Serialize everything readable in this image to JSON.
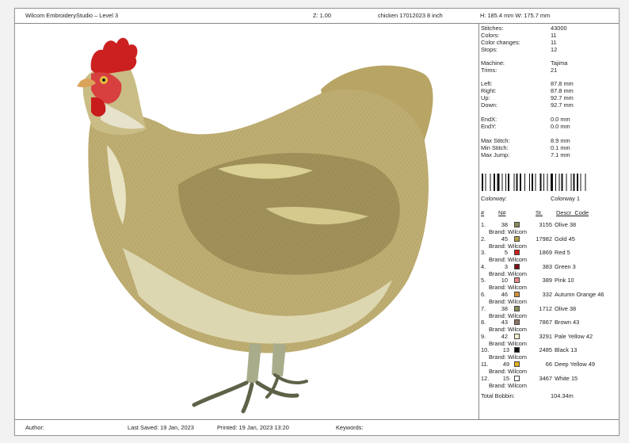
{
  "header": {
    "app_title": "Wilcom EmbroideryStudio – Level 3",
    "zoom": "Z: 1.00",
    "design_name": "chicken 17012023 8 inch",
    "size": "H: 185.4 mm   W: 175.7 mm"
  },
  "stats": [
    {
      "label": "Stitches:",
      "value": "43000"
    },
    {
      "label": "Colors:",
      "value": "11"
    },
    {
      "label": "Color changes:",
      "value": "11"
    },
    {
      "label": "Stops:",
      "value": "12"
    },
    {
      "label": "Machine:",
      "value": "Tajima"
    },
    {
      "label": "Trims:",
      "value": "21"
    },
    {
      "label": "Left:",
      "value": "87.8 mm"
    },
    {
      "label": "Right:",
      "value": "87.8 mm"
    },
    {
      "label": "Up:",
      "value": "92.7 mm"
    },
    {
      "label": "Down:",
      "value": "92.7 mm"
    },
    {
      "label": "EndX:",
      "value": "0.0 mm"
    },
    {
      "label": "EndY:",
      "value": "0.0 mm"
    },
    {
      "label": "Max Stitch:",
      "value": "8.9 mm"
    },
    {
      "label": "Min Stitch:",
      "value": "0.1 mm"
    },
    {
      "label": "Max Jump:",
      "value": "7.1 mm"
    }
  ],
  "colorway": {
    "label": "Colorway:",
    "value": "Colorway 1"
  },
  "table_headers": {
    "num": "#",
    "n": "N#",
    "st": "St.",
    "descr": "Descr_Code"
  },
  "brand_label": "Brand: Wilcom",
  "threads": [
    {
      "idx": "1.",
      "n": "38",
      "st": "3155",
      "descr": "Olive 38",
      "color": "#8b8b5c"
    },
    {
      "idx": "2.",
      "n": "45",
      "st": "17982",
      "descr": "Gold 45",
      "color": "#b8a046"
    },
    {
      "idx": "3.",
      "n": "5",
      "st": "1869",
      "descr": "Red 5",
      "color": "#d11e1e"
    },
    {
      "idx": "4.",
      "n": "3",
      "st": "383",
      "descr": "Green 3",
      "color": "#7a0f14"
    },
    {
      "idx": "5.",
      "n": "10",
      "st": "389",
      "descr": "Pink 10",
      "color": "#e88a8a"
    },
    {
      "idx": "6.",
      "n": "46",
      "st": "332",
      "descr": "Autumn Orange 46",
      "color": "#d4903a"
    },
    {
      "idx": "7.",
      "n": "38",
      "st": "1712",
      "descr": "Olive 38",
      "color": "#8b8b5c"
    },
    {
      "idx": "8.",
      "n": "43",
      "st": "7867",
      "descr": "Brown 43",
      "color": "#8c7560"
    },
    {
      "idx": "9.",
      "n": "42",
      "st": "3291",
      "descr": "Pale Yellow 42",
      "color": "#f4efc8"
    },
    {
      "idx": "10.",
      "n": "13",
      "st": "2485",
      "descr": "Black 13",
      "color": "#111111"
    },
    {
      "idx": "11.",
      "n": "49",
      "st": "66",
      "descr": "Deep Yellow 49",
      "color": "#e2b21c"
    },
    {
      "idx": "12.",
      "n": "15",
      "st": "3467",
      "descr": "White 15",
      "color": "#ffffff"
    }
  ],
  "total_bobbin": {
    "label": "Total Bobbin:",
    "value": "104.34m"
  },
  "footer": {
    "author": "Author:",
    "last_saved": "Last Saved: 19 Jan, 2023",
    "printed": "Printed: 19 Jan, 2023 13:20",
    "keywords": "Keywords:"
  },
  "design_icon": "embroidered-chicken-image"
}
